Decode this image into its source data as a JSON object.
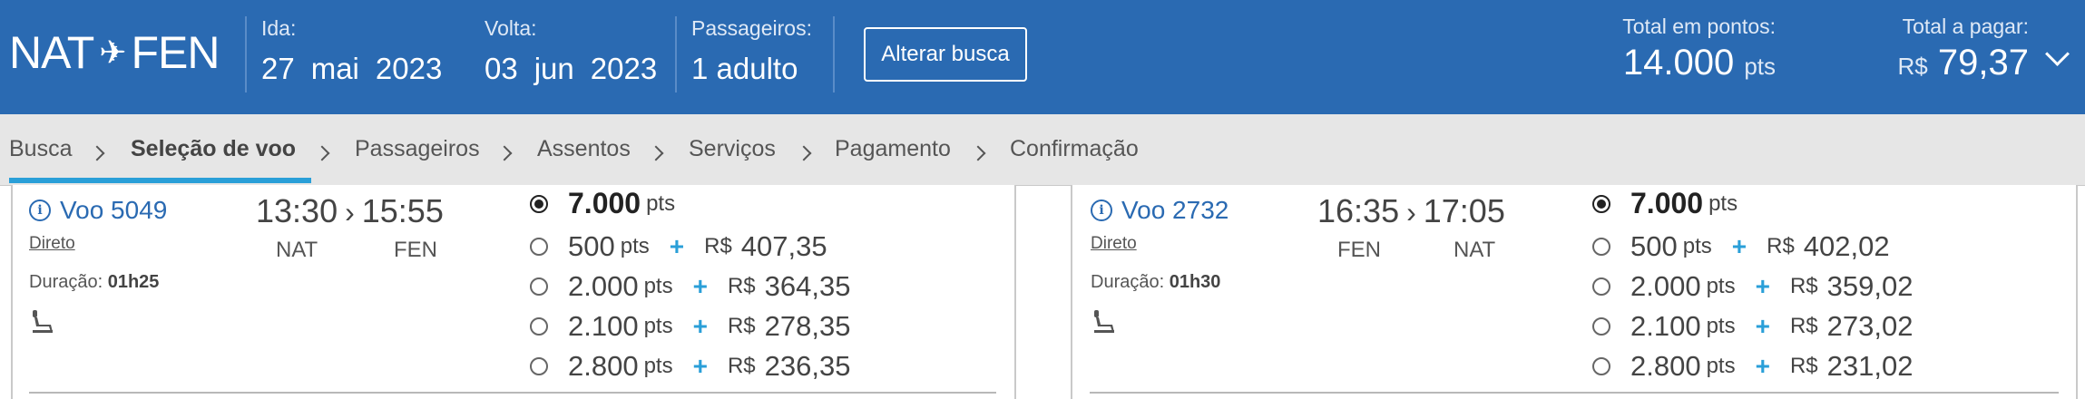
{
  "header": {
    "origin": "NAT",
    "destination": "FEN",
    "ida_label": "Ida:",
    "ida_day": "27",
    "ida_month": "mai",
    "ida_year": "2023",
    "volta_label": "Volta:",
    "volta_day": "03",
    "volta_month": "jun",
    "volta_year": "2023",
    "passengers_label": "Passageiros:",
    "passengers_value": "1 adulto",
    "change_search_label": "Alterar busca",
    "total_points_label": "Total em pontos:",
    "total_points_value": "14.000",
    "total_points_unit": "pts",
    "total_pay_label": "Total a pagar:",
    "total_pay_currency": "R$",
    "total_pay_value": "79,37"
  },
  "breadcrumb": {
    "steps": [
      "Busca",
      "Seleção de voo",
      "Passageiros",
      "Assentos",
      "Serviços",
      "Pagamento",
      "Confirmação"
    ],
    "active_index": 1
  },
  "flights": [
    {
      "number": "Voo 5049",
      "stops": "Direto",
      "duration_label": "Duração:",
      "duration": "01h25",
      "depart": "13:30",
      "arrive": "15:55",
      "from": "NAT",
      "to": "FEN",
      "fares": [
        {
          "points": "7.000",
          "unit": "pts",
          "selected": true
        },
        {
          "points": "500",
          "unit": "pts",
          "currency": "R$",
          "money": "407,35"
        },
        {
          "points": "2.000",
          "unit": "pts",
          "currency": "R$",
          "money": "364,35"
        },
        {
          "points": "2.100",
          "unit": "pts",
          "currency": "R$",
          "money": "278,35"
        },
        {
          "points": "2.800",
          "unit": "pts",
          "currency": "R$",
          "money": "236,35"
        }
      ]
    },
    {
      "number": "Voo 2732",
      "stops": "Direto",
      "duration_label": "Duração:",
      "duration": "01h30",
      "depart": "16:35",
      "arrive": "17:05",
      "from": "FEN",
      "to": "NAT",
      "fares": [
        {
          "points": "7.000",
          "unit": "pts",
          "selected": true
        },
        {
          "points": "500",
          "unit": "pts",
          "currency": "R$",
          "money": "402,02"
        },
        {
          "points": "2.000",
          "unit": "pts",
          "currency": "R$",
          "money": "359,02"
        },
        {
          "points": "2.100",
          "unit": "pts",
          "currency": "R$",
          "money": "273,02"
        },
        {
          "points": "2.800",
          "unit": "pts",
          "currency": "R$",
          "money": "231,02"
        }
      ]
    }
  ],
  "colors": {
    "header_bg": "#2a6ab2",
    "accent": "#2a9fd8",
    "link": "#2a6ab2",
    "breadcrumb_bg": "#e6e6e6"
  },
  "icons": {
    "route_separator": "airplane-icon",
    "flight_info": "info-icon",
    "seat": "seat-icon",
    "totals_toggle": "chevron-down-icon"
  }
}
